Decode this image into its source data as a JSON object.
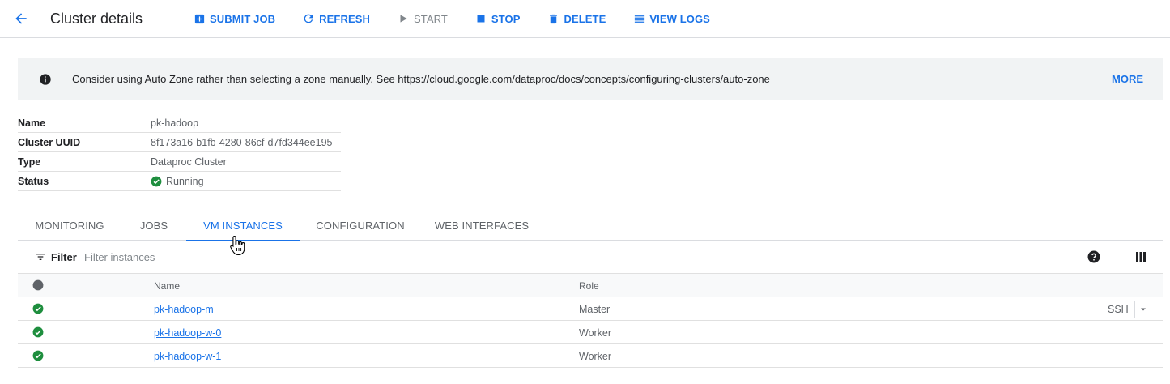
{
  "header": {
    "title": "Cluster details",
    "toolbar": [
      {
        "label": "SUBMIT JOB",
        "icon": "add-box-icon",
        "enabled": true
      },
      {
        "label": "REFRESH",
        "icon": "refresh-icon",
        "enabled": true
      },
      {
        "label": "START",
        "icon": "play-icon",
        "enabled": false
      },
      {
        "label": "STOP",
        "icon": "stop-icon",
        "enabled": true
      },
      {
        "label": "DELETE",
        "icon": "trash-icon",
        "enabled": true
      },
      {
        "label": "VIEW LOGS",
        "icon": "list-icon",
        "enabled": true
      }
    ]
  },
  "banner": {
    "message": "Consider using Auto Zone rather than selecting a zone manually. See https://cloud.google.com/dataproc/docs/concepts/configuring-clusters/auto-zone",
    "action": "MORE"
  },
  "details": [
    {
      "key": "Name",
      "value": "pk-hadoop"
    },
    {
      "key": "Cluster UUID",
      "value": "8f173a16-b1fb-4280-86cf-d7fd344ee195"
    },
    {
      "key": "Type",
      "value": "Dataproc Cluster"
    },
    {
      "key": "Status",
      "value": "Running"
    }
  ],
  "tabs": [
    {
      "label": "MONITORING",
      "active": false
    },
    {
      "label": "JOBS",
      "active": false
    },
    {
      "label": "VM INSTANCES",
      "active": true
    },
    {
      "label": "CONFIGURATION",
      "active": false
    },
    {
      "label": "WEB INTERFACES",
      "active": false
    }
  ],
  "filter": {
    "label": "Filter",
    "placeholder": "Filter instances"
  },
  "instances": {
    "columns": {
      "name": "Name",
      "role": "Role"
    },
    "rows": [
      {
        "name": "pk-hadoop-m",
        "role": "Master",
        "action": "SSH"
      },
      {
        "name": "pk-hadoop-w-0",
        "role": "Worker",
        "action": ""
      },
      {
        "name": "pk-hadoop-w-1",
        "role": "Worker",
        "action": ""
      }
    ]
  },
  "colors": {
    "accent": "#1a73e8",
    "success": "#1e8e3e",
    "disabled": "#80868b",
    "banner_bg": "#f1f3f4"
  }
}
